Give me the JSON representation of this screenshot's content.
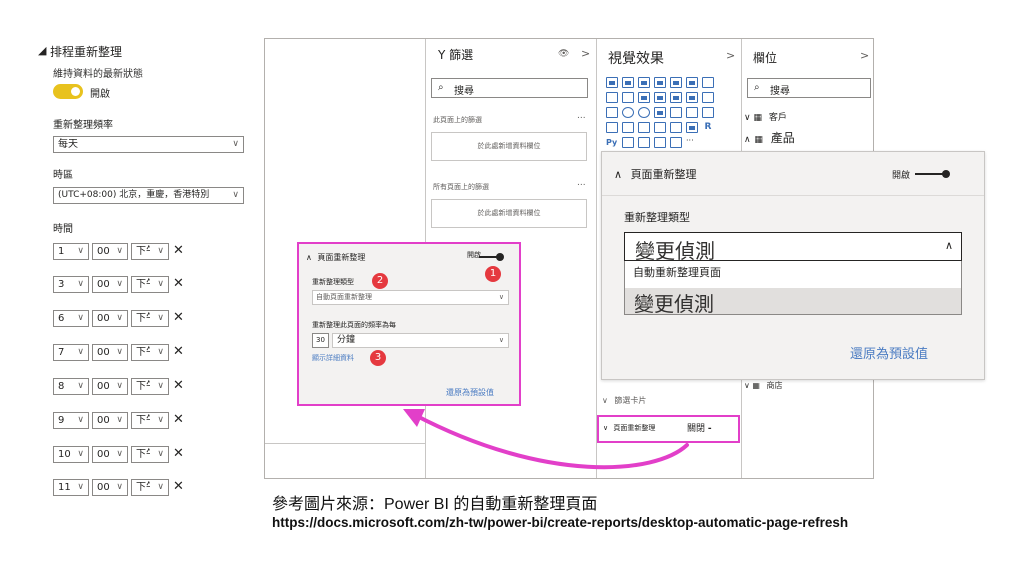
{
  "settings": {
    "section_title": "排程重新整理",
    "subtitle": "維持資料的最新狀態",
    "toggle_label": "開啟",
    "frequency_label": "重新整理頻率",
    "frequency_value": "每天",
    "timezone_label": "時區",
    "timezone_value": "(UTC+08:00) 北京，重慶，香港特別",
    "time_label": "時間",
    "times": [
      {
        "hour": "1",
        "minute": "00",
        "ampm": "下午"
      },
      {
        "hour": "3",
        "minute": "00",
        "ampm": "下午"
      },
      {
        "hour": "6",
        "minute": "00",
        "ampm": "下午"
      },
      {
        "hour": "7",
        "minute": "00",
        "ampm": "下午"
      },
      {
        "hour": "8",
        "minute": "00",
        "ampm": "下午"
      },
      {
        "hour": "9",
        "minute": "00",
        "ampm": "下午"
      },
      {
        "hour": "10",
        "minute": "00",
        "ampm": "下午"
      },
      {
        "hour": "11",
        "minute": "00",
        "ampm": "下午"
      }
    ]
  },
  "filters": {
    "title": "篩選",
    "search_placeholder": "搜尋",
    "this_page_label": "此頁面上的篩選",
    "add_field_1": "於此處新增資料欄位",
    "all_pages_label": "所有頁面上的篩選",
    "add_field_2": "於此處新增資料欄位",
    "more": "..."
  },
  "visualizations": {
    "title": "視覺效果",
    "filter_card": "篩選卡片",
    "page_refresh": "頁面重新整理",
    "page_refresh_state": "關閉"
  },
  "fields": {
    "title": "欄位",
    "search_placeholder": "搜尋",
    "items": [
      "客戶",
      "產品",
      "商店"
    ]
  },
  "small_panel": {
    "header": "頁面重新整理",
    "toggle": "開啟",
    "type_label": "重新整理類型",
    "type_value": "自動頁面重新整理",
    "interval_label": "重新整理此頁面的頻率為每",
    "interval_value": "30",
    "interval_unit": "分鐘",
    "details_link": "顯示詳細資料",
    "reset": "還原為預設值",
    "badges": [
      "1",
      "2",
      "3"
    ]
  },
  "zoom_panel": {
    "header": "頁面重新整理",
    "toggle": "開啟",
    "type_label": "重新整理類型",
    "selected": "變更偵測",
    "options": [
      "自動重新整理頁面",
      "變更偵測"
    ],
    "reset": "還原為預設值"
  },
  "caption": {
    "line1": "參考圖片來源：Power BI 的自動重新整理頁面",
    "line2": "https://docs.microsoft.com/zh-tw/power-bi/create-reports/desktop-automatic-page-refresh"
  },
  "colors": {
    "accent_pink": "#e23fc9",
    "badge_red": "#e5393f",
    "toggle_yellow": "#e8c21e",
    "link_blue": "#4b7cc2"
  }
}
